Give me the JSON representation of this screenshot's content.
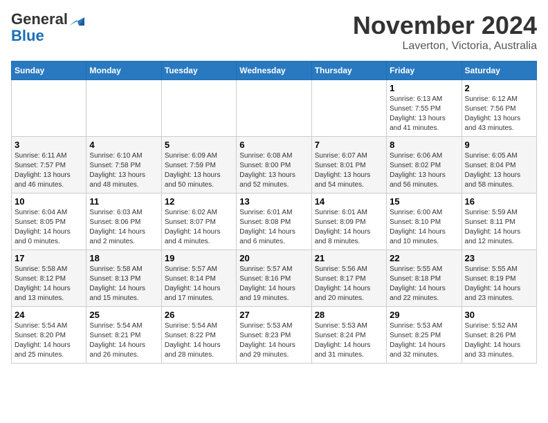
{
  "header": {
    "logo_general": "General",
    "logo_blue": "Blue",
    "title": "November 2024",
    "subtitle": "Laverton, Victoria, Australia"
  },
  "days_of_week": [
    "Sunday",
    "Monday",
    "Tuesday",
    "Wednesday",
    "Thursday",
    "Friday",
    "Saturday"
  ],
  "weeks": [
    [
      {
        "day": "",
        "info": ""
      },
      {
        "day": "",
        "info": ""
      },
      {
        "day": "",
        "info": ""
      },
      {
        "day": "",
        "info": ""
      },
      {
        "day": "",
        "info": ""
      },
      {
        "day": "1",
        "info": "Sunrise: 6:13 AM\nSunset: 7:55 PM\nDaylight: 13 hours\nand 41 minutes."
      },
      {
        "day": "2",
        "info": "Sunrise: 6:12 AM\nSunset: 7:56 PM\nDaylight: 13 hours\nand 43 minutes."
      }
    ],
    [
      {
        "day": "3",
        "info": "Sunrise: 6:11 AM\nSunset: 7:57 PM\nDaylight: 13 hours\nand 46 minutes."
      },
      {
        "day": "4",
        "info": "Sunrise: 6:10 AM\nSunset: 7:58 PM\nDaylight: 13 hours\nand 48 minutes."
      },
      {
        "day": "5",
        "info": "Sunrise: 6:09 AM\nSunset: 7:59 PM\nDaylight: 13 hours\nand 50 minutes."
      },
      {
        "day": "6",
        "info": "Sunrise: 6:08 AM\nSunset: 8:00 PM\nDaylight: 13 hours\nand 52 minutes."
      },
      {
        "day": "7",
        "info": "Sunrise: 6:07 AM\nSunset: 8:01 PM\nDaylight: 13 hours\nand 54 minutes."
      },
      {
        "day": "8",
        "info": "Sunrise: 6:06 AM\nSunset: 8:02 PM\nDaylight: 13 hours\nand 56 minutes."
      },
      {
        "day": "9",
        "info": "Sunrise: 6:05 AM\nSunset: 8:04 PM\nDaylight: 13 hours\nand 58 minutes."
      }
    ],
    [
      {
        "day": "10",
        "info": "Sunrise: 6:04 AM\nSunset: 8:05 PM\nDaylight: 14 hours\nand 0 minutes."
      },
      {
        "day": "11",
        "info": "Sunrise: 6:03 AM\nSunset: 8:06 PM\nDaylight: 14 hours\nand 2 minutes."
      },
      {
        "day": "12",
        "info": "Sunrise: 6:02 AM\nSunset: 8:07 PM\nDaylight: 14 hours\nand 4 minutes."
      },
      {
        "day": "13",
        "info": "Sunrise: 6:01 AM\nSunset: 8:08 PM\nDaylight: 14 hours\nand 6 minutes."
      },
      {
        "day": "14",
        "info": "Sunrise: 6:01 AM\nSunset: 8:09 PM\nDaylight: 14 hours\nand 8 minutes."
      },
      {
        "day": "15",
        "info": "Sunrise: 6:00 AM\nSunset: 8:10 PM\nDaylight: 14 hours\nand 10 minutes."
      },
      {
        "day": "16",
        "info": "Sunrise: 5:59 AM\nSunset: 8:11 PM\nDaylight: 14 hours\nand 12 minutes."
      }
    ],
    [
      {
        "day": "17",
        "info": "Sunrise: 5:58 AM\nSunset: 8:12 PM\nDaylight: 14 hours\nand 13 minutes."
      },
      {
        "day": "18",
        "info": "Sunrise: 5:58 AM\nSunset: 8:13 PM\nDaylight: 14 hours\nand 15 minutes."
      },
      {
        "day": "19",
        "info": "Sunrise: 5:57 AM\nSunset: 8:14 PM\nDaylight: 14 hours\nand 17 minutes."
      },
      {
        "day": "20",
        "info": "Sunrise: 5:57 AM\nSunset: 8:16 PM\nDaylight: 14 hours\nand 19 minutes."
      },
      {
        "day": "21",
        "info": "Sunrise: 5:56 AM\nSunset: 8:17 PM\nDaylight: 14 hours\nand 20 minutes."
      },
      {
        "day": "22",
        "info": "Sunrise: 5:55 AM\nSunset: 8:18 PM\nDaylight: 14 hours\nand 22 minutes."
      },
      {
        "day": "23",
        "info": "Sunrise: 5:55 AM\nSunset: 8:19 PM\nDaylight: 14 hours\nand 23 minutes."
      }
    ],
    [
      {
        "day": "24",
        "info": "Sunrise: 5:54 AM\nSunset: 8:20 PM\nDaylight: 14 hours\nand 25 minutes."
      },
      {
        "day": "25",
        "info": "Sunrise: 5:54 AM\nSunset: 8:21 PM\nDaylight: 14 hours\nand 26 minutes."
      },
      {
        "day": "26",
        "info": "Sunrise: 5:54 AM\nSunset: 8:22 PM\nDaylight: 14 hours\nand 28 minutes."
      },
      {
        "day": "27",
        "info": "Sunrise: 5:53 AM\nSunset: 8:23 PM\nDaylight: 14 hours\nand 29 minutes."
      },
      {
        "day": "28",
        "info": "Sunrise: 5:53 AM\nSunset: 8:24 PM\nDaylight: 14 hours\nand 31 minutes."
      },
      {
        "day": "29",
        "info": "Sunrise: 5:53 AM\nSunset: 8:25 PM\nDaylight: 14 hours\nand 32 minutes."
      },
      {
        "day": "30",
        "info": "Sunrise: 5:52 AM\nSunset: 8:26 PM\nDaylight: 14 hours\nand 33 minutes."
      }
    ]
  ]
}
